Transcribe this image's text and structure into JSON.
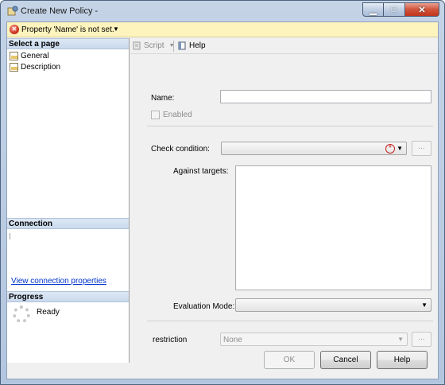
{
  "window": {
    "title": "Create New Policy -"
  },
  "warning": {
    "text": "Property 'Name' is not set."
  },
  "left": {
    "select_page_header": "Select a page",
    "pages": [
      {
        "label": "General"
      },
      {
        "label": "Description"
      }
    ],
    "connection_header": "Connection",
    "connection_link": "View connection properties",
    "progress_header": "Progress",
    "progress_status": "Ready"
  },
  "toolbar": {
    "script_label": "Script",
    "help_label": "Help"
  },
  "form": {
    "name_label": "Name:",
    "name_value": "",
    "enabled_label": "Enabled",
    "check_condition_label": "Check condition:",
    "check_condition_value": "",
    "against_targets_label": "Against targets:",
    "evaluation_mode_label": "Evaluation Mode:",
    "evaluation_mode_value": "",
    "restriction_label": "restriction",
    "restriction_value": "None",
    "ellipsis": "..."
  },
  "buttons": {
    "ok": "OK",
    "cancel": "Cancel",
    "help": "Help"
  }
}
